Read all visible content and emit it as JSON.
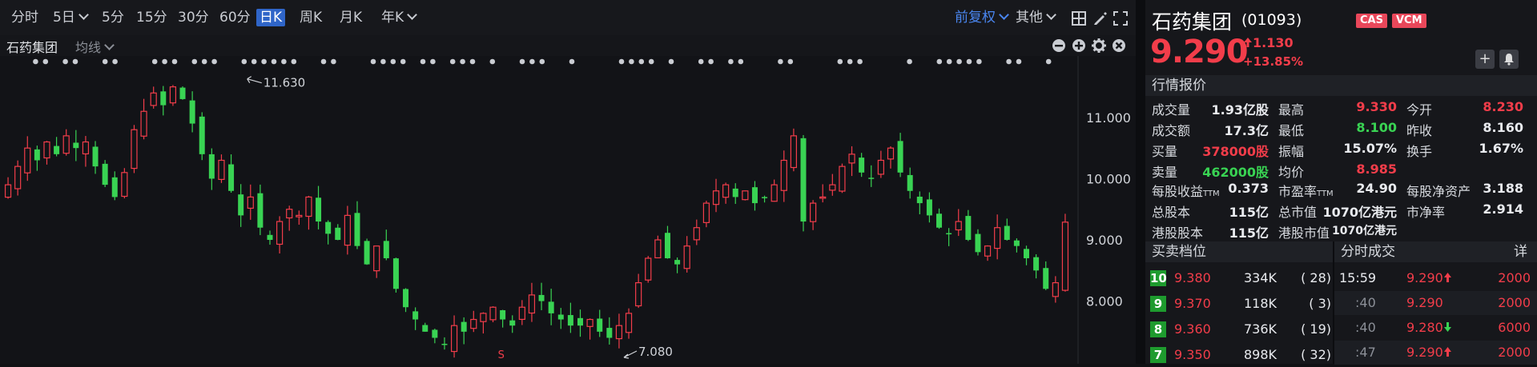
{
  "toolbar": {
    "periods": [
      "分时",
      "5日",
      "5分",
      "15分",
      "30分",
      "60分",
      "日K",
      "周K",
      "月K",
      "年K"
    ],
    "active": "日K",
    "adjust": "前复权",
    "other": "其他"
  },
  "chart_head": {
    "name": "石药集团",
    "indicator": "均线"
  },
  "chart_data": {
    "type": "candlestick",
    "y_ticks": [
      "11.000",
      "10.000",
      "9.000",
      "8.000"
    ],
    "y_tick_values": [
      11,
      10,
      9,
      8
    ],
    "ylim": [
      7.08,
      11.9
    ],
    "annotations": [
      {
        "label": "11.630",
        "value": 11.63
      },
      {
        "label": "7.080",
        "value": 7.08
      }
    ],
    "marker_label": "S",
    "close_series": [
      9.9,
      10.2,
      10.5,
      10.3,
      10.6,
      10.4,
      10.7,
      10.5,
      10.6,
      10.2,
      9.9,
      9.7,
      10.1,
      10.8,
      11.1,
      11.4,
      11.2,
      11.5,
      11.3,
      10.9,
      10.4,
      10.0,
      10.3,
      9.8,
      9.4,
      9.7,
      9.2,
      9.0,
      9.3,
      9.5,
      9.4,
      9.7,
      9.3,
      9.1,
      9.0,
      9.4,
      8.9,
      8.6,
      8.9,
      8.7,
      8.2,
      7.9,
      7.7,
      7.5,
      7.4,
      7.3,
      7.6,
      7.5,
      7.7,
      7.8,
      7.9,
      7.7,
      7.6,
      7.9,
      8.1,
      8.0,
      7.8,
      7.7,
      7.6,
      7.6,
      7.7,
      7.5,
      7.4,
      7.6,
      7.8,
      8.3,
      8.7,
      9.0,
      8.7,
      8.6,
      8.9,
      9.2,
      9.6,
      9.8,
      9.9,
      9.7,
      9.8,
      9.6,
      9.7,
      9.9,
      10.3,
      10.7,
      9.3,
      9.6,
      9.7,
      9.9,
      10.2,
      10.4,
      10.1,
      10.0,
      10.3,
      10.5,
      10.1,
      9.8,
      9.6,
      9.4,
      9.2,
      9.1,
      9.3,
      9.0,
      8.8,
      8.9,
      9.2,
      9.0,
      8.9,
      8.7,
      8.5,
      8.2,
      8.3,
      9.29
    ]
  },
  "quote": {
    "name": "石药集团",
    "code": "(01093)",
    "badges": [
      "CAS",
      "VCM"
    ],
    "badge_colors": [
      "#e9475a",
      "#e9475a"
    ],
    "price": "9.290",
    "change": "1.130",
    "change_pct": "+13.85%"
  },
  "sections": {
    "market": "行情报价",
    "orderbook": "买卖档位",
    "ticks": "分时成交",
    "detail": "详"
  },
  "stats": [
    [
      {
        "l": "成交量",
        "v": "1.93亿股",
        "c": "white"
      },
      {
        "l": "最高",
        "v": "9.330",
        "c": "red"
      },
      {
        "l": "今开",
        "v": "8.230",
        "c": "red"
      }
    ],
    [
      {
        "l": "成交额",
        "v": "17.3亿",
        "c": "white"
      },
      {
        "l": "最低",
        "v": "8.100",
        "c": "green"
      },
      {
        "l": "昨收",
        "v": "8.160",
        "c": "white"
      }
    ],
    [
      {
        "l": "买量",
        "v": "378000股",
        "c": "red"
      },
      {
        "l": "振幅",
        "v": "15.07%",
        "c": "white"
      },
      {
        "l": "换手",
        "v": "1.67%",
        "c": "white"
      }
    ],
    [
      {
        "l": "卖量",
        "v": "462000股",
        "c": "green"
      },
      {
        "l": "均价",
        "v": "8.985",
        "c": "red"
      },
      {
        "l": "",
        "v": "",
        "c": "white"
      }
    ]
  ],
  "fundamentals": [
    [
      {
        "l": "每股收益",
        "s": "TTM",
        "v": "0.373"
      },
      {
        "l": "市盈率",
        "s": "TTM",
        "v": "24.90"
      },
      {
        "l": "每股净资产",
        "s": "",
        "v": "3.188"
      }
    ],
    [
      {
        "l": "总股本",
        "s": "",
        "v": "115亿"
      },
      {
        "l": "总市值",
        "s": "",
        "v": "1070亿港元"
      },
      {
        "l": "市净率",
        "s": "",
        "v": "2.914"
      }
    ],
    [
      {
        "l": "港股股本",
        "s": "",
        "v": "115亿"
      },
      {
        "l": "港股市值",
        "s": "",
        "v": "1070亿港元"
      },
      {
        "l": "",
        "s": "",
        "v": ""
      }
    ]
  ],
  "orderbook": [
    {
      "lvl": "10",
      "price": "9.380",
      "vol": "334K",
      "cnt": "( 28)"
    },
    {
      "lvl": "9",
      "price": "9.370",
      "vol": "118K",
      "cnt": "( 3)"
    },
    {
      "lvl": "8",
      "price": "9.360",
      "vol": "736K",
      "cnt": "( 19)"
    },
    {
      "lvl": "7",
      "price": "9.350",
      "vol": "898K",
      "cnt": "( 32)"
    }
  ],
  "ticks": [
    {
      "time": "15:59",
      "price": "9.290",
      "dir": "up",
      "vol": "2000"
    },
    {
      "time": ":40",
      "price": "9.290",
      "dir": "",
      "vol": "2000"
    },
    {
      "time": ":40",
      "price": "9.280",
      "dir": "down",
      "vol": "6000"
    },
    {
      "time": ":47",
      "price": "9.290",
      "dir": "up",
      "vol": "2000"
    }
  ]
}
